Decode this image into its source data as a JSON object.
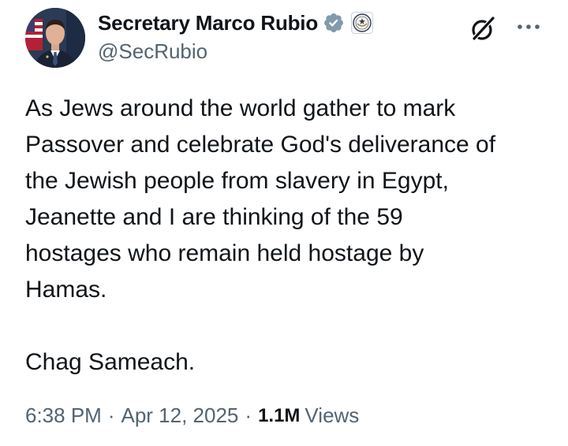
{
  "author": {
    "display_name": "Secretary Marco Rubio",
    "handle": "@SecRubio",
    "verified_badge_color": "#829aab",
    "affiliation_badge": "department-of-state-seal-icon"
  },
  "actions": {
    "grok_icon": "grok-icon",
    "more_icon": "more-dots-icon"
  },
  "post": {
    "text": "As Jews around the world gather to mark\nPassover and celebrate God's deliverance of\nthe Jewish people from slavery in Egypt,\nJeanette and I are thinking of the 59\nhostages who remain held hostage by\nHamas.\n\nChag Sameach."
  },
  "meta": {
    "time": "6:38 PM",
    "separator": "·",
    "date": "Apr 12, 2025",
    "views_count": "1.1M",
    "views_label": "Views"
  },
  "colors": {
    "text_primary": "#0f1419",
    "text_secondary": "#536471",
    "background": "#ffffff"
  }
}
